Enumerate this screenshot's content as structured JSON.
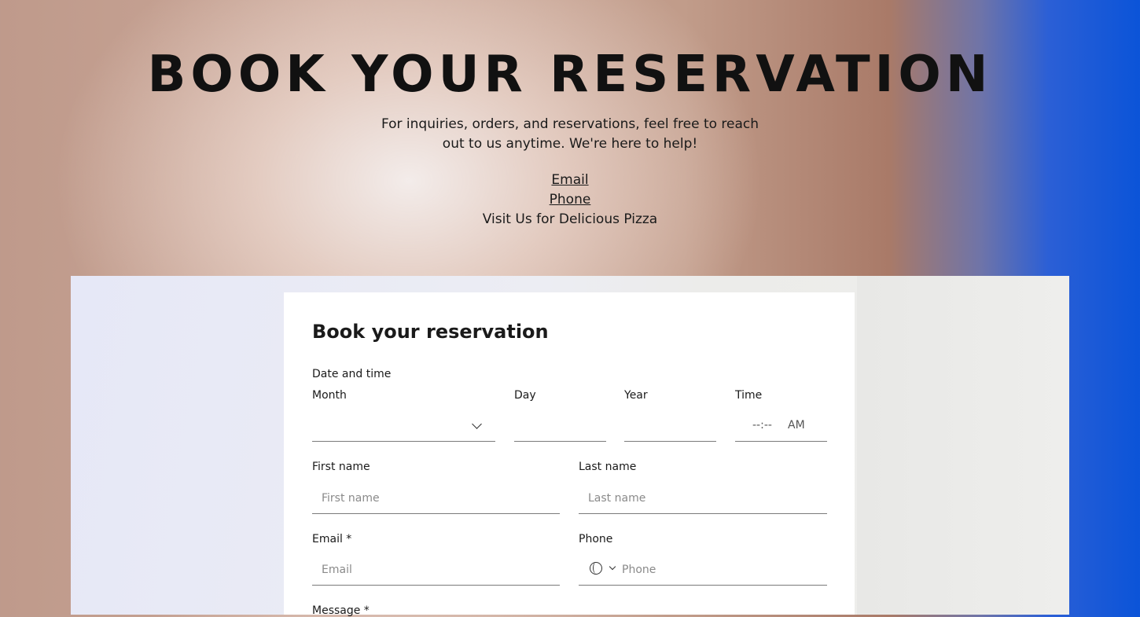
{
  "hero": {
    "title": "BOOK YOUR RESERVATION",
    "description": "For inquiries, orders, and reservations, feel free to reach out to us anytime. We're here to help!",
    "email_link": "Email",
    "phone_link": "Phone",
    "visit_text": "Visit Us for Delicious Pizza"
  },
  "form": {
    "title": "Book your reservation",
    "date_time_label": "Date and time",
    "month_label": "Month",
    "day_label": "Day",
    "year_label": "Year",
    "time_label": "Time",
    "time_value": "--:--",
    "time_period": "AM",
    "first_name_label": "First name",
    "first_name_placeholder": "First name",
    "last_name_label": "Last name",
    "last_name_placeholder": "Last name",
    "email_label": "Email *",
    "email_placeholder": "Email",
    "phone_label": "Phone",
    "phone_placeholder": "Phone",
    "message_label": "Message *"
  }
}
